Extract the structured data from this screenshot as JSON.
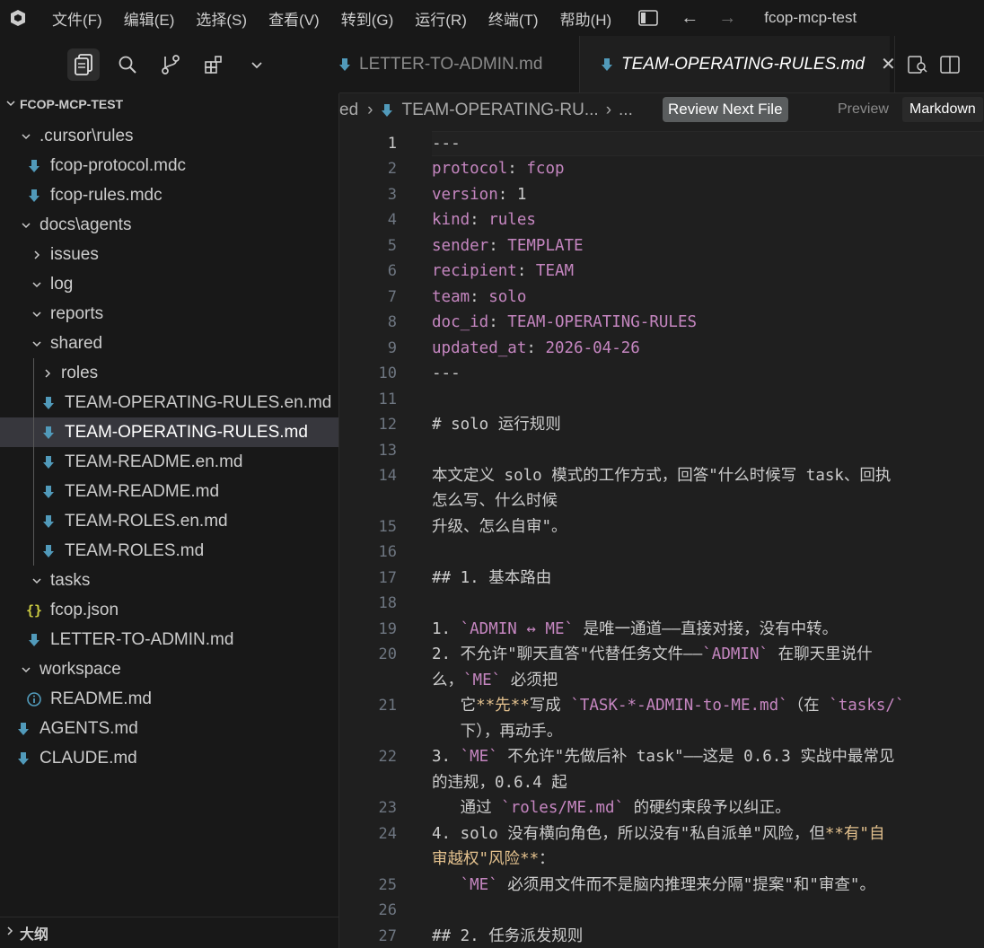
{
  "titlebar": {
    "menus": [
      "文件(F)",
      "编辑(E)",
      "选择(S)",
      "查看(V)",
      "转到(G)",
      "运行(R)",
      "终端(T)",
      "帮助(H)"
    ],
    "window_title": "fcop-mcp-test"
  },
  "activity_bar": {
    "icons": [
      "explorer-icon",
      "search-icon",
      "source-control-icon",
      "extensions-icon",
      "chevron-down-icon"
    ]
  },
  "explorer": {
    "root_label": "FCOP-MCP-TEST",
    "tree": [
      {
        "label": ".cursor\\rules",
        "type": "folder-open"
      },
      {
        "label": "fcop-protocol.mdc",
        "type": "md"
      },
      {
        "label": "fcop-rules.mdc",
        "type": "md"
      },
      {
        "label": "docs\\agents",
        "type": "folder-open"
      },
      {
        "label": "issues",
        "type": "folder-closed"
      },
      {
        "label": "log",
        "type": "folder-open"
      },
      {
        "label": "reports",
        "type": "folder-open"
      },
      {
        "label": "shared",
        "type": "folder-open"
      },
      {
        "label": "roles",
        "type": "folder-closed"
      },
      {
        "label": "TEAM-OPERATING-RULES.en.md",
        "type": "md"
      },
      {
        "label": "TEAM-OPERATING-RULES.md",
        "type": "md"
      },
      {
        "label": "TEAM-README.en.md",
        "type": "md"
      },
      {
        "label": "TEAM-README.md",
        "type": "md"
      },
      {
        "label": "TEAM-ROLES.en.md",
        "type": "md"
      },
      {
        "label": "TEAM-ROLES.md",
        "type": "md"
      },
      {
        "label": "tasks",
        "type": "folder-open"
      },
      {
        "label": "fcop.json",
        "type": "json"
      },
      {
        "label": "LETTER-TO-ADMIN.md",
        "type": "md"
      },
      {
        "label": "workspace",
        "type": "folder-open"
      },
      {
        "label": "README.md",
        "type": "info"
      },
      {
        "label": "AGENTS.md",
        "type": "md"
      },
      {
        "label": "CLAUDE.md",
        "type": "md"
      }
    ],
    "outline_label": "大纲"
  },
  "tabs": {
    "inactive_label": "LETTER-TO-ADMIN.md",
    "active_label": "TEAM-OPERATING-RULES.md",
    "close_glyph": "✕"
  },
  "breadcrumb": {
    "prefix": "ed",
    "file": "TEAM-OPERATING-RU...",
    "ellipsis": "...",
    "review_button": "Review Next File",
    "preview_button": "Preview",
    "markdown_button": "Markdown"
  },
  "editor": {
    "line_numbers": [
      "1",
      "2",
      "3",
      "4",
      "5",
      "6",
      "7",
      "8",
      "9",
      "10",
      "11",
      "12",
      "13",
      "14",
      "15",
      "16",
      "17",
      "18",
      "19",
      "20",
      "21",
      "22",
      "23",
      "24",
      "25",
      "26",
      "27"
    ],
    "lines": {
      "l1": "---",
      "l2k": "protocol",
      "l2v": "fcop",
      "l3k": "version",
      "l3v": "1",
      "l4k": "kind",
      "l4v": "rules",
      "l5k": "sender",
      "l5v": "TEMPLATE",
      "l6k": "recipient",
      "l6v": "TEAM",
      "l7k": "team",
      "l7v": "solo",
      "l8k": "doc_id",
      "l8v": "TEAM-OPERATING-RULES",
      "l9k": "updated_at",
      "l9v": "2026-04-26",
      "l10": "---",
      "l12": "# solo 运行规则",
      "l14a": "本文定义 solo 模式的工作方式，回答\"什么时候写 task、回执",
      "l14b": "怎么写、什么时候",
      "l15": "升级、怎么自审\"。",
      "l17": "## 1. 基本路由",
      "l19a": "1. ",
      "l19b": "`ADMIN ↔ ME`",
      "l19c": " 是唯一通道——直接对接，没有中转。",
      "l20a": "2. 不允许\"聊天直答\"代替任务文件——",
      "l20b": "`ADMIN`",
      "l20c": " 在聊天里说什",
      "l20d": "么，",
      "l20e": "`ME`",
      "l20f": " 必须把",
      "l21a": "   它",
      "l21b": "**先**",
      "l21c": "写成 ",
      "l21d": "`TASK-*-ADMIN-to-ME.md`",
      "l21e": "（在 ",
      "l21f": "`tasks/`",
      "l21g": "   下），再动手。",
      "l22a": "3. ",
      "l22b": "`ME`",
      "l22c": " 不允许\"先做后补 task\"——这是 0.6.3 实战中最常见",
      "l22d": "的违规，0.6.4 起",
      "l23a": "   通过 ",
      "l23b": "`roles/ME.md`",
      "l23c": " 的硬约束段予以纠正。",
      "l24a": "4. solo 没有横向角色，所以没有\"私自派单\"风险，但",
      "l24b": "**有\"自",
      "l24c": "审越权\"风险**",
      "l24d": "：",
      "l25a": "   ",
      "l25b": "`ME`",
      "l25c": " 必须用文件而不是脑内推理来分隔\"提案\"和\"审查\"。",
      "l27": "## 2. 任务派发规则"
    }
  }
}
